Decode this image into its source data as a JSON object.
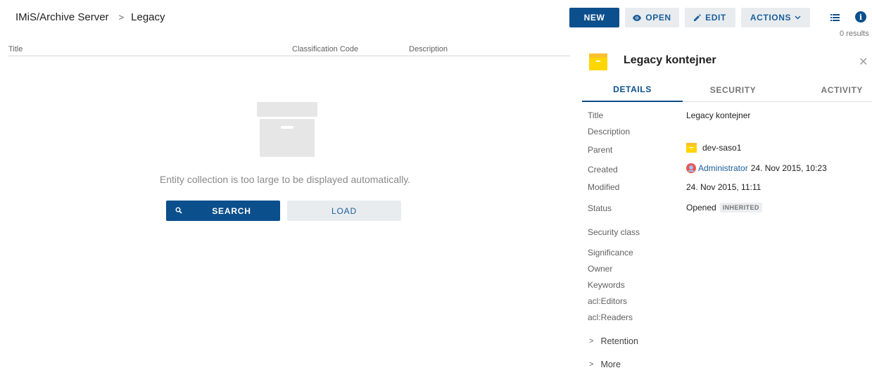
{
  "breadcrumb": {
    "root": "IMiS/Archive Server",
    "separator": ">",
    "current": "Legacy"
  },
  "toolbar": {
    "new": "NEW",
    "open": "OPEN",
    "edit": "EDIT",
    "actions": "ACTIONS",
    "results": "0 results"
  },
  "table": {
    "columns": [
      "Title",
      "Classification Code",
      "Description"
    ]
  },
  "empty_state": {
    "message": "Entity collection is too large to be displayed automatically.",
    "search_label": "SEARCH",
    "load_label": "LOAD"
  },
  "panel": {
    "title": "Legacy kontejner",
    "close_icon": "close-icon",
    "tabs": [
      "DETAILS",
      "SECURITY",
      "ACTIVITY"
    ],
    "active_tab": "DETAILS",
    "props": {
      "title_label": "Title",
      "title_value": "Legacy kontejner",
      "description_label": "Description",
      "parent_label": "Parent",
      "parent_value": "dev-saso1",
      "created_label": "Created",
      "created_user": "Administrator",
      "created_date": "24. Nov 2015, 10:23",
      "modified_label": "Modified",
      "modified_value": "24. Nov 2015, 11:11",
      "status_label": "Status",
      "status_value": "Opened",
      "status_badge": "INHERITED",
      "security_class_label": "Security class",
      "significance_label": "Significance",
      "owner_label": "Owner",
      "keywords_label": "Keywords",
      "acl_editors_label": "acl:Editors",
      "acl_readers_label": "acl:Readers"
    },
    "sections": {
      "retention": "Retention",
      "more": "More"
    }
  },
  "colors": {
    "primary": "#0b4f8c",
    "folder": "#ffd600",
    "link": "#1a5e9a"
  }
}
